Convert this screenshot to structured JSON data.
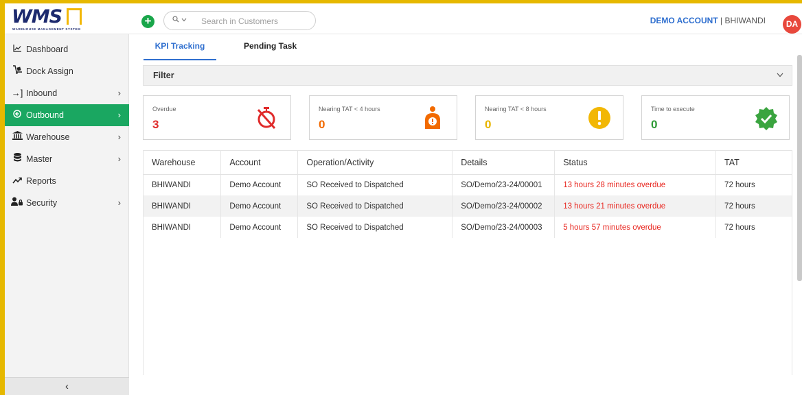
{
  "header": {
    "logo_text": "WMS",
    "logo_subtitle": "WAREHOUSE MANAGEMENT SYSTEM",
    "add_icon": "plus-circle-icon",
    "search": {
      "placeholder": "Search in Customers",
      "value": "",
      "icon": "search-icon"
    },
    "account_name": "DEMO ACCOUNT",
    "separator": "|",
    "location": "BHIWANDI",
    "avatar_initials": "DA",
    "colors": {
      "brand_navy": "#1d2a6e",
      "brand_yellow": "#f2b705",
      "avatar": "#e8483c",
      "add": "#19a64a"
    }
  },
  "sidebar": {
    "items": [
      {
        "label": "Dashboard",
        "icon": "chart-line-icon",
        "has_arrow": false,
        "active": false
      },
      {
        "label": "Dock Assign",
        "icon": "dolly-icon",
        "has_arrow": false,
        "active": false
      },
      {
        "label": "Inbound",
        "icon": "sign-in-icon",
        "has_arrow": true,
        "active": false
      },
      {
        "label": "Outbound",
        "icon": "circle-arrow-left-icon",
        "has_arrow": true,
        "active": true
      },
      {
        "label": "Warehouse",
        "icon": "bank-building-icon",
        "has_arrow": true,
        "active": false
      },
      {
        "label": "Master",
        "icon": "database-icon",
        "has_arrow": true,
        "active": false
      },
      {
        "label": "Reports",
        "icon": "trend-up-icon",
        "has_arrow": false,
        "active": false
      },
      {
        "label": "Security",
        "icon": "user-lock-icon",
        "has_arrow": true,
        "active": false
      }
    ],
    "collapse_icon": "chevron-left-icon",
    "active_color": "#1aa761"
  },
  "tabs": [
    {
      "label": "KPI Tracking",
      "active": true
    },
    {
      "label": "Pending Task",
      "active": false
    }
  ],
  "filter": {
    "label": "Filter",
    "icon": "chevron-down-icon"
  },
  "kpi_cards": [
    {
      "label": "Overdue",
      "value": "3",
      "color": "#e02b2b",
      "icon": "timer-off-icon"
    },
    {
      "label": "Nearing TAT < 4 hours",
      "value": "0",
      "color": "#f26a00",
      "icon": "person-alert-icon"
    },
    {
      "label": "Nearing TAT < 8 hours",
      "value": "0",
      "color": "#e8b500",
      "icon": "exclamation-circle-icon"
    },
    {
      "label": "Time to execute",
      "value": "0",
      "color": "#2e9a36",
      "icon": "check-badge-icon"
    }
  ],
  "table": {
    "headers": [
      "Warehouse",
      "Account",
      "Operation/Activity",
      "Details",
      "Status",
      "TAT"
    ],
    "rows": [
      [
        "BHIWANDI",
        "Demo Account",
        "SO Received to Dispatched",
        "SO/Demo/23-24/00001",
        "13 hours 28 minutes overdue",
        "72 hours"
      ],
      [
        "BHIWANDI",
        "Demo Account",
        "SO Received to Dispatched",
        "SO/Demo/23-24/00002",
        "13 hours 21 minutes overdue",
        "72 hours"
      ],
      [
        "BHIWANDI",
        "Demo Account",
        "SO Received to Dispatched",
        "SO/Demo/23-24/00003",
        "5 hours 57 minutes overdue",
        "72 hours"
      ]
    ],
    "status_color": "#e8261f"
  }
}
